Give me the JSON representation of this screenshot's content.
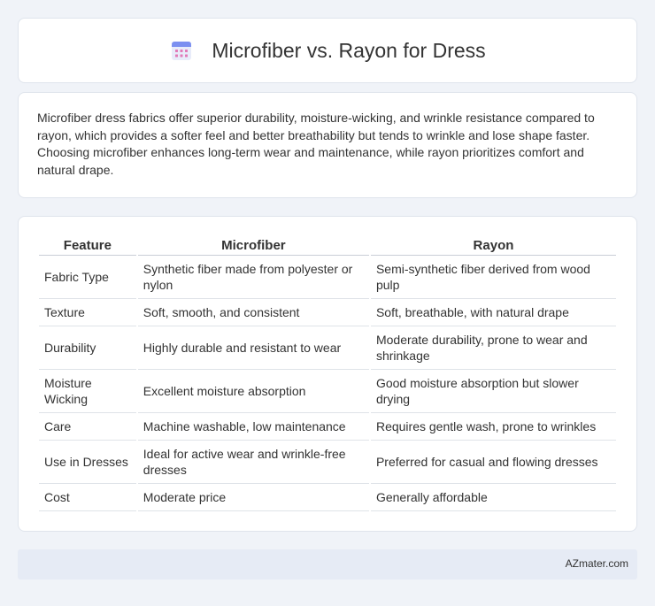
{
  "header": {
    "title": "Microfiber vs. Rayon for Dress",
    "icon": "calendar-icon"
  },
  "summary": {
    "text": "Microfiber dress fabrics offer superior durability, moisture-wicking, and wrinkle resistance compared to rayon, which provides a softer feel and better breathability but tends to wrinkle and lose shape faster. Choosing microfiber enhances long-term wear and maintenance, while rayon prioritizes comfort and natural drape."
  },
  "table": {
    "headers": [
      "Feature",
      "Microfiber",
      "Rayon"
    ],
    "rows": [
      [
        "Fabric Type",
        "Synthetic fiber made from polyester or nylon",
        "Semi-synthetic fiber derived from wood pulp"
      ],
      [
        "Texture",
        "Soft, smooth, and consistent",
        "Soft, breathable, with natural drape"
      ],
      [
        "Durability",
        "Highly durable and resistant to wear",
        "Moderate durability, prone to wear and shrinkage"
      ],
      [
        "Moisture Wicking",
        "Excellent moisture absorption",
        "Good moisture absorption but slower drying"
      ],
      [
        "Care",
        "Machine washable, low maintenance",
        "Requires gentle wash, prone to wrinkles"
      ],
      [
        "Use in Dresses",
        "Ideal for active wear and wrinkle-free dresses",
        "Preferred for casual and flowing dresses"
      ],
      [
        "Cost",
        "Moderate price",
        "Generally affordable"
      ]
    ]
  },
  "footer": {
    "text": "AZmater.com"
  }
}
